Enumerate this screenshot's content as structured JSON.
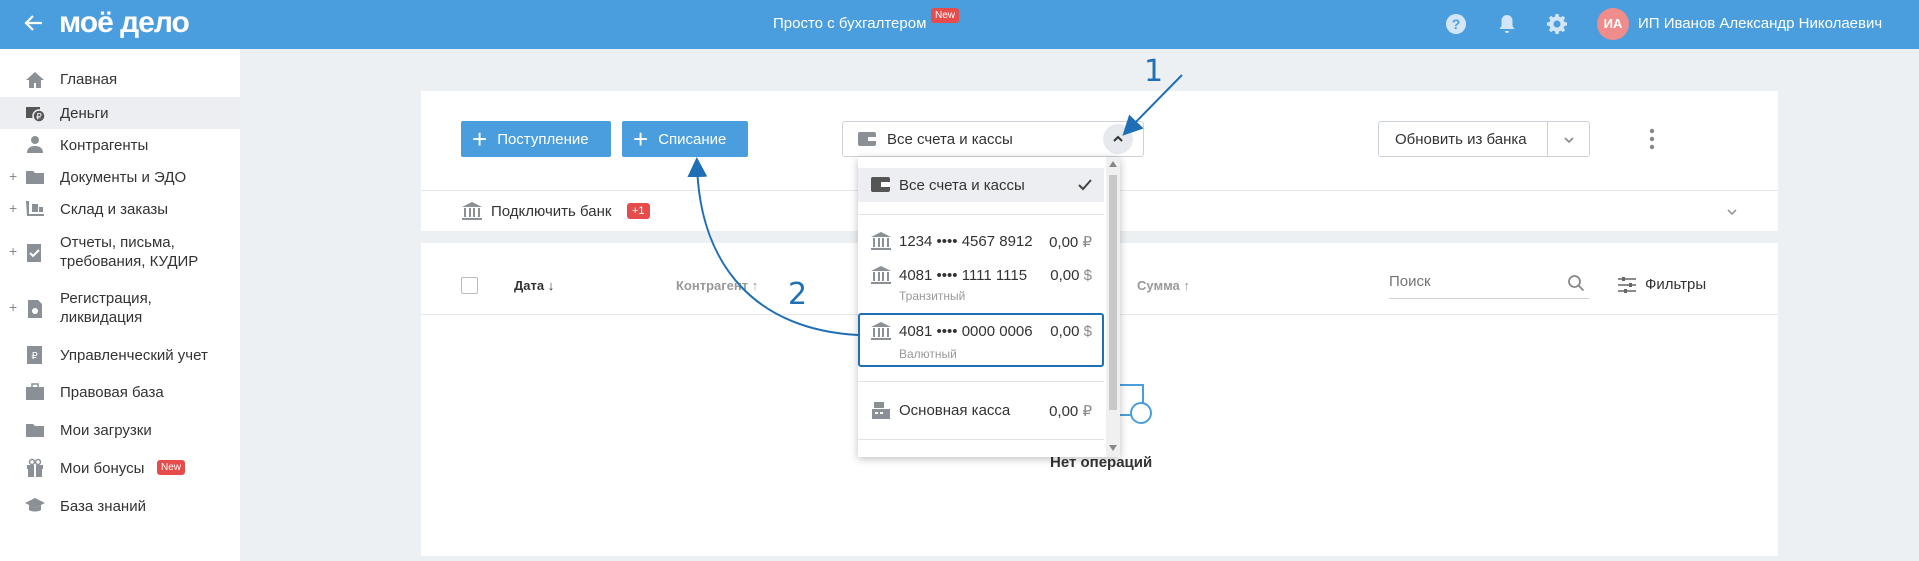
{
  "header": {
    "logo": "моё дело",
    "center_title": "Просто с бухгалтером",
    "center_badge": "New",
    "avatar_initials": "ИА",
    "user_name": "ИП Иванов Александр Николаевич"
  },
  "sidebar": {
    "items": [
      {
        "label": "Главная",
        "icon": "home-icon"
      },
      {
        "label": "Деньги",
        "icon": "money-icon"
      },
      {
        "label": "Контрагенты",
        "icon": "contractors-icon"
      },
      {
        "label": "Документы и ЭДО",
        "icon": "folder-icon"
      },
      {
        "label": "Склад и заказы",
        "icon": "warehouse-icon"
      },
      {
        "label": "Отчеты, письма,",
        "label2": "требования, КУДИР",
        "icon": "reports-icon"
      },
      {
        "label": "Регистрация,",
        "label2": "ликвидация",
        "icon": "registration-icon"
      },
      {
        "label": "Управленческий учет",
        "icon": "management-icon"
      },
      {
        "label": "Правовая база",
        "icon": "briefcase-icon"
      },
      {
        "label": "Мои загрузки",
        "icon": "downloads-icon"
      },
      {
        "label": "Мои бонусы",
        "badge": "New",
        "icon": "gift-icon"
      },
      {
        "label": "База знаний",
        "icon": "graduation-icon"
      }
    ]
  },
  "toolbar": {
    "income_label": "Поступление",
    "expense_label": "Списание",
    "account_select": "Все счета и кассы",
    "update_bank_label": "Обновить из банка"
  },
  "bank_row": {
    "label": "Подключить банк",
    "badge": "+1"
  },
  "table": {
    "col_date": "Дата",
    "col_contractor": "Контрагент",
    "col_sum": "Сумма",
    "search_placeholder": "Поиск",
    "filters_label": "Фильтры",
    "empty_text": "Нет операций"
  },
  "dropdown": {
    "all_label": "Все счета и кассы",
    "accounts": [
      {
        "name": "1234 •••• 4567 8912",
        "amount": "0,00",
        "currency": "₽",
        "sub": ""
      },
      {
        "name": "4081 •••• 1111 1115",
        "amount": "0,00",
        "currency": "$",
        "sub": "Транзитный"
      },
      {
        "name": "4081 •••• 0000 0006",
        "amount": "0,00",
        "currency": "$",
        "sub": "Валютный"
      }
    ],
    "cash": {
      "name": "Основная касса",
      "amount": "0,00",
      "currency": "₽"
    }
  },
  "annotations": {
    "one": "1",
    "two": "2"
  },
  "colors": {
    "brand_blue": "#4b9ede",
    "annotation_blue": "#1e6fb5",
    "badge_red": "#e74c4c"
  }
}
